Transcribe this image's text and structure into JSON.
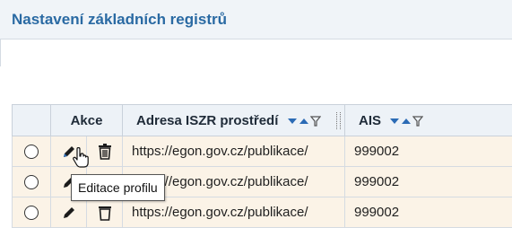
{
  "panel": {
    "title": "Nastavení základních registrů"
  },
  "table": {
    "columns": [
      {
        "label": ""
      },
      {
        "label": "Akce"
      },
      {
        "label": "Adresa ISZR prostředí",
        "sortable": true,
        "filterable": true
      },
      {
        "label": "AIS",
        "sortable": true,
        "filterable": true
      }
    ],
    "rows": [
      {
        "address": "https://egon.gov.cz/publikace/",
        "ais": "999002"
      },
      {
        "address": "https://egon.gov.cz/publikace/",
        "ais": "999002"
      },
      {
        "address": "https://egon.gov.cz/publikace/",
        "ais": "999002"
      }
    ]
  },
  "tooltip": {
    "text": "Editace profilu"
  },
  "icons": {
    "edit": "pencil-icon",
    "delete": "trash-icon",
    "sort": "sort-arrows-icon",
    "filter": "filter-icon",
    "cursor": "hand-pointer-icon"
  },
  "colors": {
    "title": "#2a6aa3",
    "sort_arrow": "#2b6bb5",
    "row_highlight": "#fbf3e7",
    "header_bg": "#edf2f7"
  }
}
